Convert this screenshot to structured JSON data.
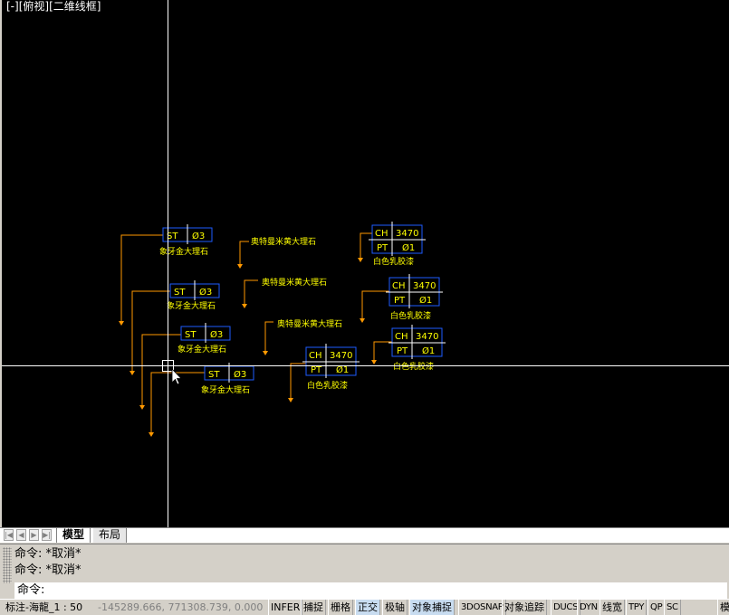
{
  "viewport": {
    "controls": [
      "[-]",
      "[俯视]",
      "[二维线框]"
    ]
  },
  "drawing": {
    "materials": {
      "ivory": "象牙金大理石",
      "otto": "奥特曼米黄大理石",
      "white_latex": "白色乳胶漆"
    },
    "tags": {
      "st_code": "ST",
      "st_num": "Ø3",
      "ch_code": "CH",
      "ch_num": "3470",
      "pt_code": "PT",
      "pt_num": "Ø1"
    },
    "colors": {
      "background": "#000000",
      "text": "#ffff00",
      "tag_box": "#1e5cff",
      "leader": "#ff9900",
      "crosshair": "#ffffff"
    }
  },
  "tabs": {
    "model": "模型",
    "layout": "布局"
  },
  "command": {
    "history": [
      "命令: *取消*",
      "命令: *取消*"
    ],
    "prompt": "命令:"
  },
  "status": {
    "annotation": "标注-海龍_1 : 50",
    "coords": "-145289.666,  771308.739,  0.000",
    "buttons": [
      {
        "label": "INFER",
        "on": false
      },
      {
        "label": "捕捉",
        "on": false
      },
      {
        "label": "栅格",
        "on": false
      },
      {
        "label": "正交",
        "on": true
      },
      {
        "label": "极轴",
        "on": false
      },
      {
        "label": "对象捕捉",
        "on": true
      },
      {
        "label": "3DOSNAP",
        "on": false
      },
      {
        "label": "对象追踪",
        "on": false
      },
      {
        "label": "DUCS",
        "on": false
      },
      {
        "label": "DYN",
        "on": false
      },
      {
        "label": "线宽",
        "on": false
      },
      {
        "label": "TPY",
        "on": false
      },
      {
        "label": "QP",
        "on": false
      },
      {
        "label": "SC",
        "on": false
      }
    ],
    "right_label": "模"
  }
}
